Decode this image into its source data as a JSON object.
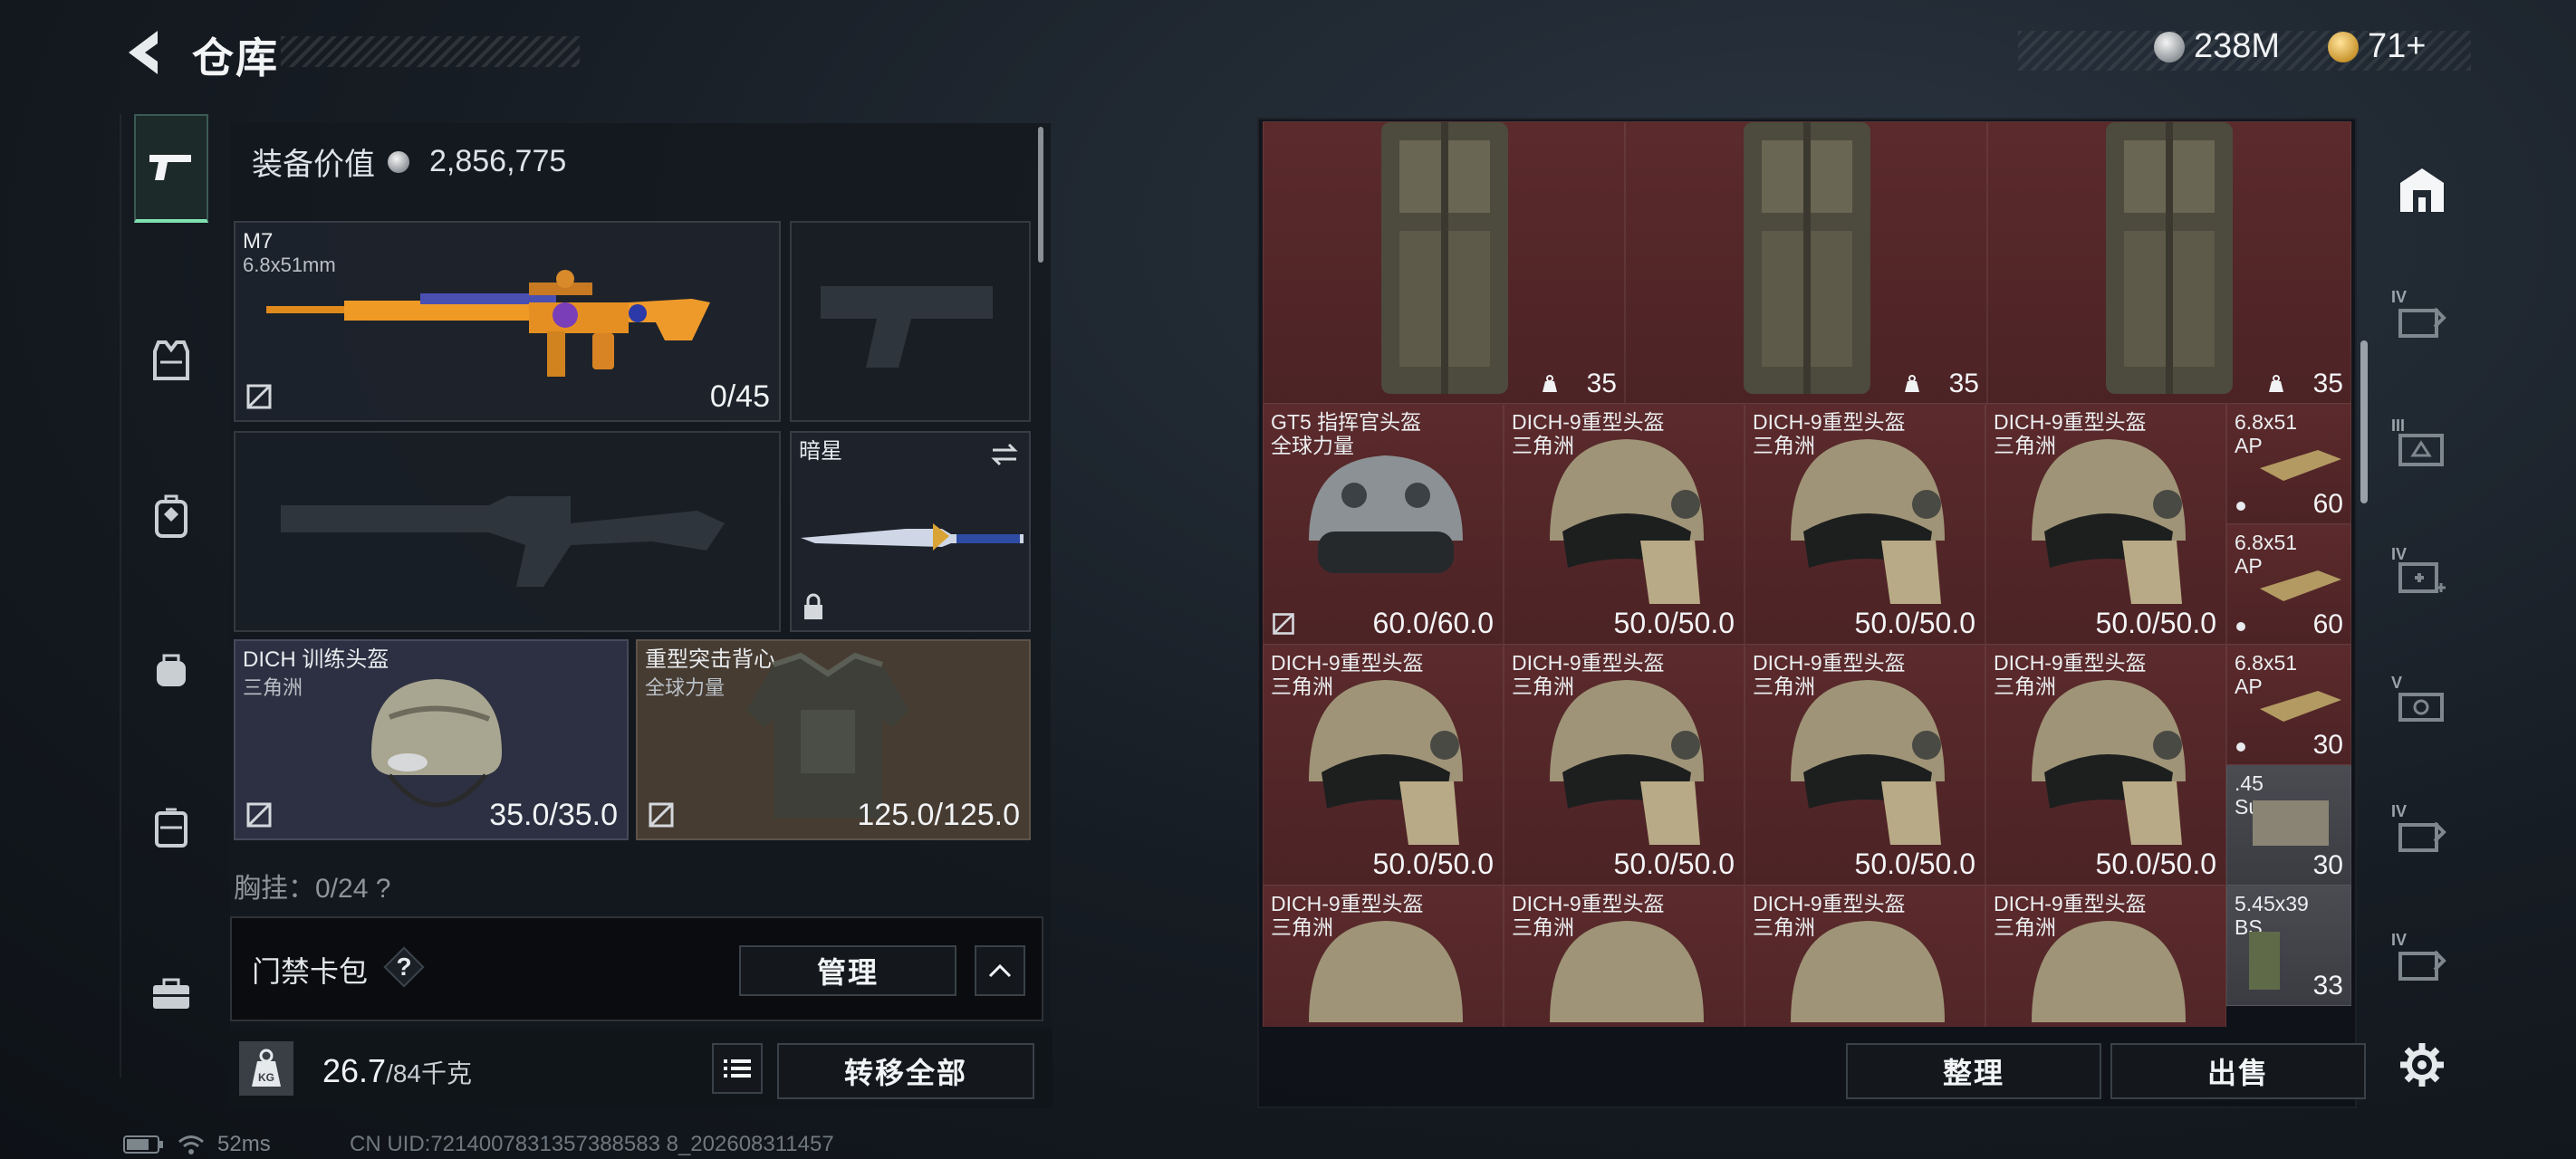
{
  "header": {
    "title": "仓库",
    "currencies": [
      {
        "icon": "silver-coin-icon",
        "amount": "238M"
      },
      {
        "icon": "gold-coin-icon",
        "amount": "71+"
      }
    ]
  },
  "categories": [
    {
      "name": "weapons",
      "icon": "pistol-icon",
      "active": true
    },
    {
      "name": "armor",
      "icon": "vest-icon"
    },
    {
      "name": "backpack",
      "icon": "backpack-icon"
    },
    {
      "name": "bag",
      "icon": "bag-icon"
    },
    {
      "name": "chest-rig",
      "icon": "rig-icon"
    },
    {
      "name": "toolbox",
      "icon": "toolbox-icon"
    }
  ],
  "equipment": {
    "value_label": "装备价值",
    "value": "2,856,775",
    "primary_weapon": {
      "name": "M7",
      "caliber": "6.8x51mm",
      "ammo": "0/45"
    },
    "melee": {
      "name": "暗星"
    },
    "helmet": {
      "name": "DICH 训练头盔",
      "origin": "三角洲",
      "durability": "35.0/35.0"
    },
    "armor": {
      "name": "重型突击背心",
      "origin": "全球力量",
      "durability": "125.0/125.0"
    },
    "chest_rig": "胸挂：0/24 ?",
    "card_pack": {
      "label": "门禁卡包",
      "help": "?",
      "manage": "管理"
    },
    "weight": {
      "current": "26.7",
      "max": "/84千克"
    },
    "transfer_all": "转移全部"
  },
  "storage": {
    "backpacks": [
      {
        "count": "35"
      },
      {
        "count": "35"
      },
      {
        "count": "35"
      }
    ],
    "rows": [
      [
        {
          "name": "GT5 指挥官头盔",
          "origin": "全球力量",
          "durability": "60.0/60.0",
          "type": "commander"
        },
        {
          "name": "DICH-9重型头盔",
          "origin": "三角洲",
          "durability": "50.0/50.0"
        },
        {
          "name": "DICH-9重型头盔",
          "origin": "三角洲",
          "durability": "50.0/50.0"
        },
        {
          "name": "DICH-9重型头盔",
          "origin": "三角洲",
          "durability": "50.0/50.0"
        }
      ],
      [
        {
          "name": "DICH-9重型头盔",
          "origin": "三角洲",
          "durability": "50.0/50.0"
        },
        {
          "name": "DICH-9重型头盔",
          "origin": "三角洲",
          "durability": "50.0/50.0"
        },
        {
          "name": "DICH-9重型头盔",
          "origin": "三角洲",
          "durability": "50.0/50.0"
        },
        {
          "name": "DICH-9重型头盔",
          "origin": "三角洲",
          "durability": "50.0/50.0"
        }
      ],
      [
        {
          "name": "DICH-9重型头盔",
          "origin": "三角洲"
        },
        {
          "name": "DICH-9重型头盔",
          "origin": "三角洲"
        },
        {
          "name": "DICH-9重型头盔",
          "origin": "三角洲"
        },
        {
          "name": "DICH-9重型头盔",
          "origin": "三角洲"
        }
      ]
    ],
    "ammo": [
      {
        "name1": "6.8x51",
        "name2": "AP",
        "count": "60"
      },
      {
        "name1": "6.8x51",
        "name2": "AP",
        "count": "60"
      },
      {
        "name1": "6.8x51",
        "name2": "AP",
        "count": "30"
      },
      {
        "name1": ".45",
        "name2": "Super",
        "count": "30"
      },
      {
        "name1": "5.45x39",
        "name2": "BS",
        "count": "33"
      }
    ],
    "sort_button": "整理",
    "sell_button": "出售"
  },
  "right_tabs": [
    {
      "icon": "storage-icon",
      "active": true
    },
    {
      "icon": "expansion-box-icon",
      "level": "IV"
    },
    {
      "icon": "expansion-box-icon",
      "level": "III"
    },
    {
      "icon": "medical-box-icon",
      "level": "IV"
    },
    {
      "icon": "ammo-box-icon",
      "level": "V"
    },
    {
      "icon": "expansion-box-icon",
      "level": "IV"
    },
    {
      "icon": "expansion-box-icon",
      "level": "IV"
    }
  ],
  "status_bar": {
    "ping": "52ms",
    "uid": "CN UID:7214007831357388583 8_202608311457"
  }
}
